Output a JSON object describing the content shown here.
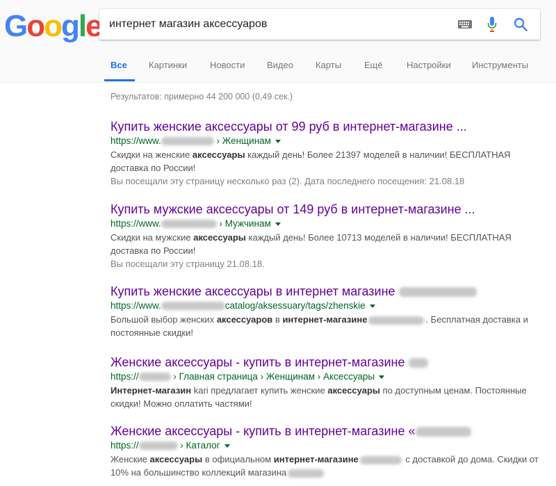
{
  "logo": {
    "text": "Google",
    "letters": [
      "G",
      "o",
      "o",
      "g",
      "l",
      "e"
    ],
    "colors": [
      "#4285F4",
      "#EA4335",
      "#FBBC05",
      "#4285F4",
      "#34A853",
      "#EA4335"
    ]
  },
  "search": {
    "query": "интернет магазин аксессуаров"
  },
  "icons": {
    "keyboard": "keyboard-icon",
    "mic": "mic-icon",
    "search": "search-icon"
  },
  "tabs": [
    {
      "label": "Все",
      "active": true
    },
    {
      "label": "Картинки"
    },
    {
      "label": "Новости"
    },
    {
      "label": "Видео"
    },
    {
      "label": "Карты"
    },
    {
      "label": "Ещё"
    },
    {
      "label": "Настройки"
    },
    {
      "label": "Инструменты"
    }
  ],
  "stats": "Результатов: примерно 44 200 000 (0,49 сек.)",
  "results": [
    {
      "title": "Купить женские аксессуары от 99 руб в интернет-магазине ...",
      "url_prefix": "https://www.",
      "url_suffix": " › Женщинам",
      "snippet": [
        {
          "t": "Скидки на женские "
        },
        {
          "b": "аксессуары"
        },
        {
          "t": " каждый день! Более 21397 моделей в наличии! БЕСПЛАТНАЯ доставка по России!"
        }
      ],
      "visited": "Вы посещали эту страницу несколько раз (2). Дата последнего посещения: 21.08.18"
    },
    {
      "title": "Купить мужские аксессуары от 149 руб в интернет-магазине ...",
      "url_prefix": "https://www.",
      "url_suffix": " › Мужчинам",
      "snippet": [
        {
          "t": "Скидки на мужские "
        },
        {
          "b": "аксессуары"
        },
        {
          "t": " каждый день! Более 10713 моделей в наличии! БЕСПЛАТНАЯ доставка по России!"
        }
      ],
      "visited": "Вы посещали эту страницу 21.08.18."
    },
    {
      "title": "Купить женские аксессуары в интернет магазине",
      "url_prefix": "https://www.",
      "url_suffix": "catalog/aksessuary/tags/zhenskie",
      "snippet": [
        {
          "t": "Большой выбор женских "
        },
        {
          "b": "аксессуаров"
        },
        {
          "t": " в "
        },
        {
          "b": "интернет-магазине"
        },
        {
          "blur": 1
        },
        {
          "t": ". Бесплатная доставка и постоянные скидки!"
        }
      ],
      "visited": ""
    },
    {
      "title": "Женские аксессуары - купить в интернет-магазине",
      "url_prefix": "https://",
      "url_suffix": " › Главная страница › Женщинам › Аксессуары",
      "snippet": [
        {
          "b": "Интернет-магазин"
        },
        {
          "t": " kari предлагает купить женские "
        },
        {
          "b": "аксессуары"
        },
        {
          "t": " по доступным ценам. Постоянные скидки! Можно оплатить частями!"
        }
      ],
      "visited": ""
    },
    {
      "title": "Женские аксессуары - купить в интернет-магазине «",
      "url_prefix": "https://",
      "url_suffix": " › Каталог",
      "snippet": [
        {
          "t": "Женские "
        },
        {
          "b": "аксессуары"
        },
        {
          "t": " в официальном "
        },
        {
          "b": "интернет-магазине"
        },
        {
          "blur": 1
        },
        {
          "t": " с доставкой до дома. Скидки от 10% на большинство коллекций магазина"
        },
        {
          "blur": 1
        }
      ],
      "visited": ""
    }
  ]
}
